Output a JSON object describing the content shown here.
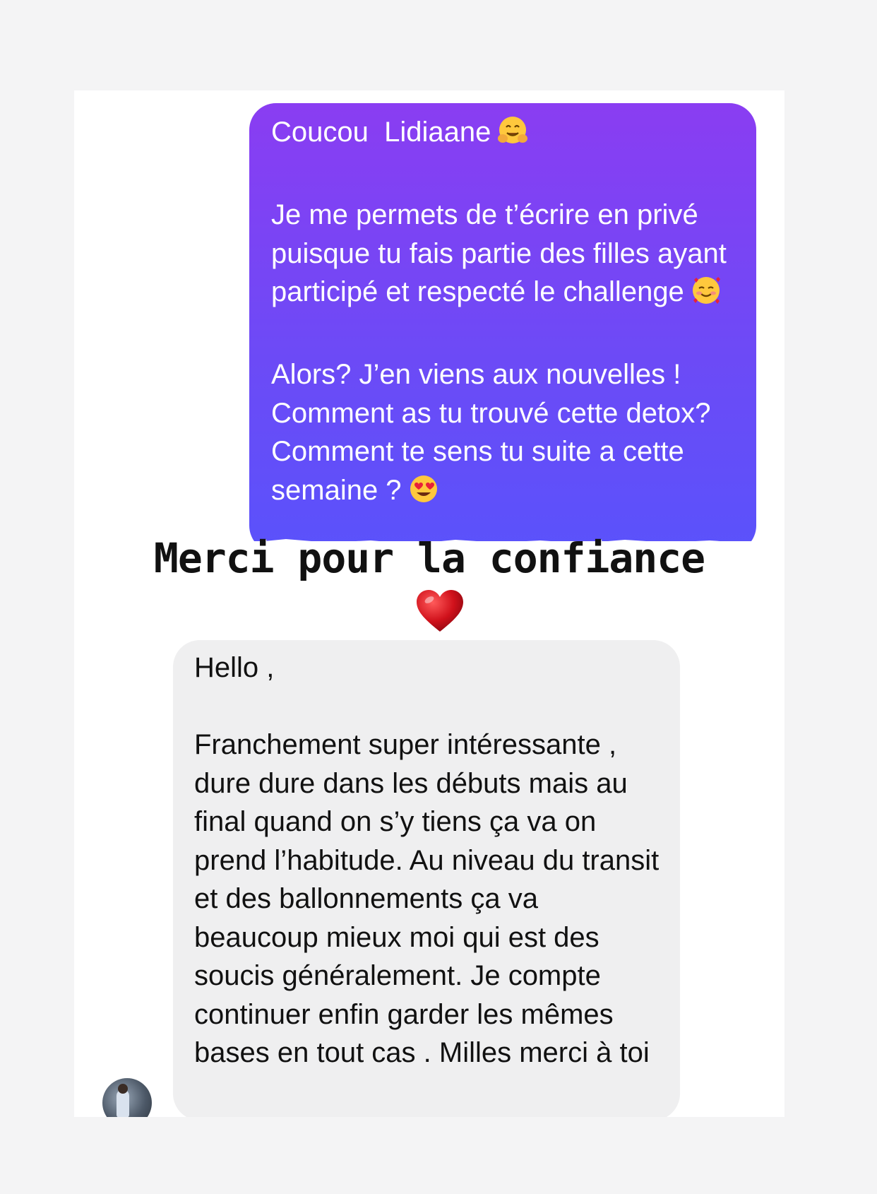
{
  "sent_message": {
    "line1": "Coucou  Lidiaane",
    "line1_emoji": "hugging-face",
    "paragraph2": "Je me permets de t’écrire en privé puisque tu fais partie des filles ayant participé et respecté le challenge",
    "paragraph2_emoji": "smiling-face-with-hearts",
    "paragraph3": "Alors? J’en viens aux nouvelles ! Comment as tu trouvé cette detox? Comment te sens tu suite a cette semaine ?",
    "paragraph3_emoji": "heart-eyes"
  },
  "overlay": {
    "caption": "Merci pour la confiance",
    "sticker": "red-heart"
  },
  "received_message": {
    "greeting": "Hello ,",
    "body": "Franchement super intéressante , dure dure dans les débuts mais au final quand on s’y tiens ça va on prend l’habitude. Au niveau du transit et des ballonnements ça va beaucoup mieux moi qui est des soucis généralement. Je compte continuer enfin garder les mêmes bases en tout cas . Milles merci à toi"
  },
  "colors": {
    "page_background": "#f4f4f5",
    "sent_gradient_top": "#8a3df2",
    "sent_gradient_bottom": "#5a52fb",
    "received_bubble": "#efeff0",
    "heart": "#d0111b"
  }
}
